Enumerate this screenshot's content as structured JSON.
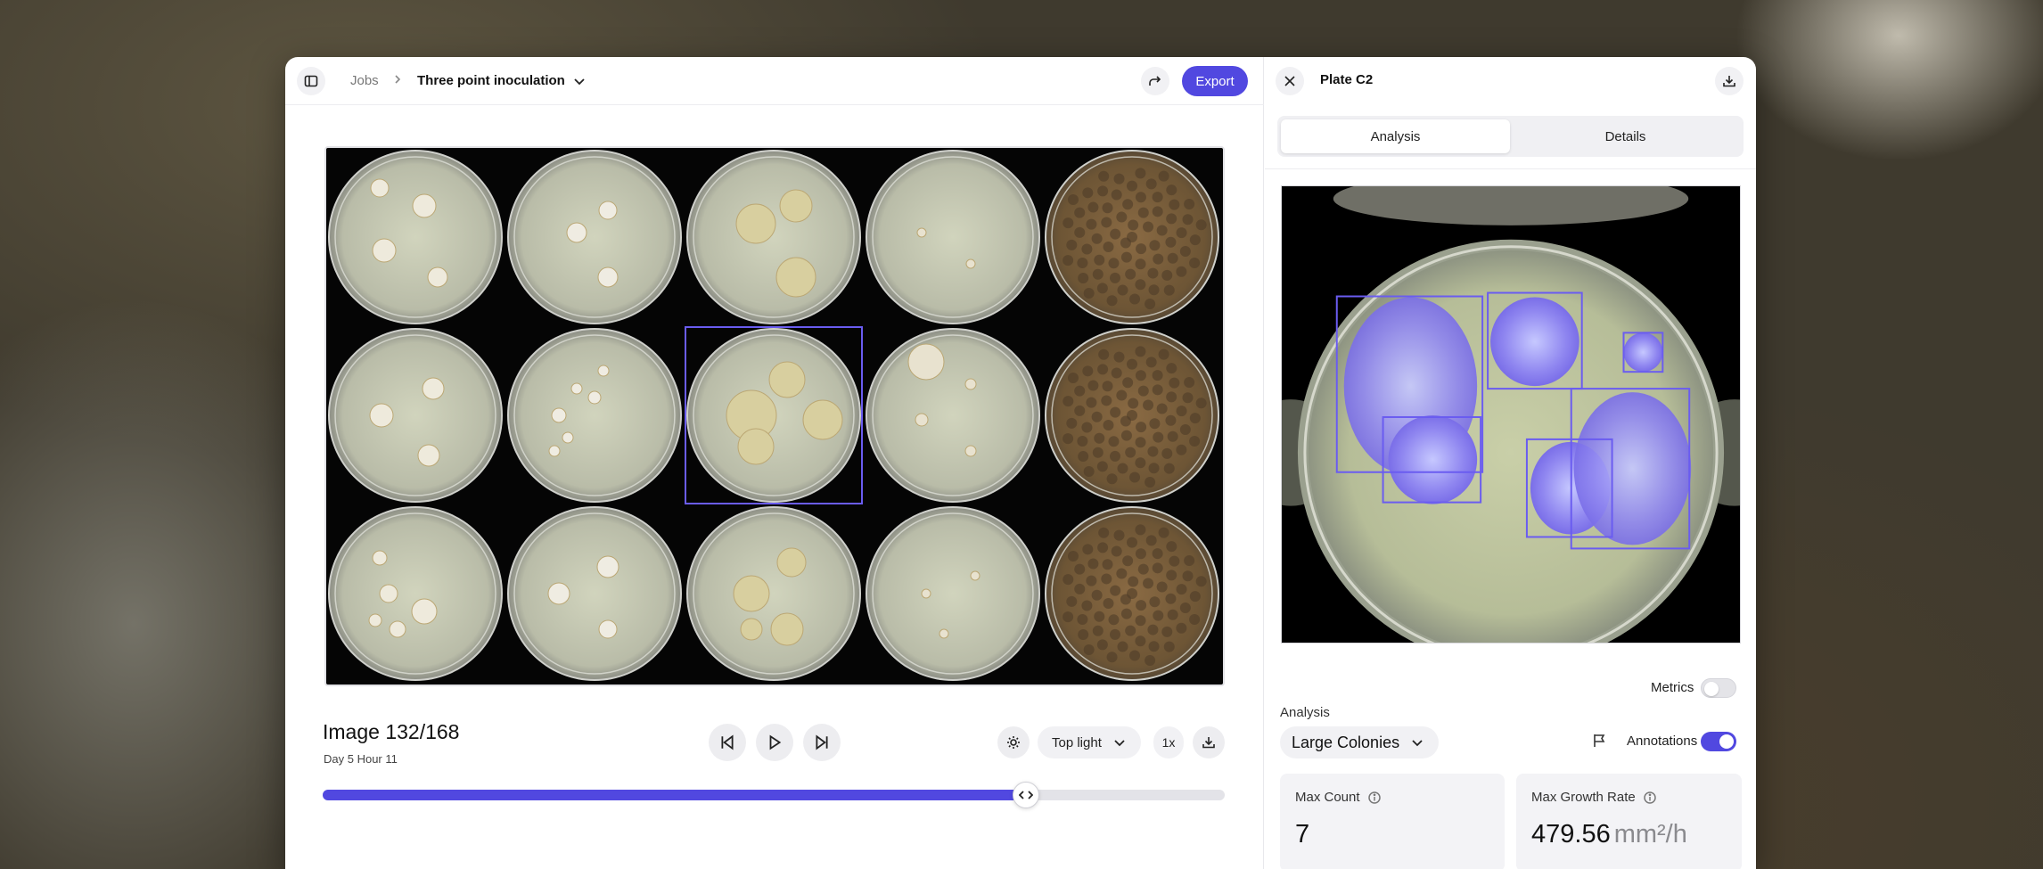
{
  "header": {
    "breadcrumb_root": "Jobs",
    "job_name": "Three point inoculation",
    "export_label": "Export"
  },
  "viewer": {
    "image_title": "Image 132/168",
    "image_subtitle": "Day 5 Hour 11",
    "lighting": "Top light",
    "speed": "1x",
    "progress_fraction": 0.78
  },
  "panel": {
    "plate_title": "Plate C2",
    "tabs": [
      "Analysis",
      "Details"
    ],
    "active_tab": "Analysis",
    "metrics_label": "Metrics",
    "metrics_enabled": false,
    "analysis_label": "Analysis",
    "analysis_value": "Large Colonies",
    "annotations_label": "Annotations",
    "annotations_enabled": true
  },
  "stats": [
    {
      "label": "Max Count",
      "value": "7",
      "unit": ""
    },
    {
      "label": "Max Growth Rate",
      "value": "479.56",
      "unit": "mm²/h"
    }
  ],
  "colors": {
    "accent": "#5148e0",
    "selection_box": "#6a5cf0"
  },
  "icons": [
    "sidebar-icon",
    "chevron-right-icon",
    "chevron-down-icon",
    "share-icon",
    "close-icon",
    "download-icon",
    "skip-back-icon",
    "play-icon",
    "skip-forward-icon",
    "sun-icon",
    "flag-icon",
    "info-icon",
    "code-arrows-icon"
  ]
}
